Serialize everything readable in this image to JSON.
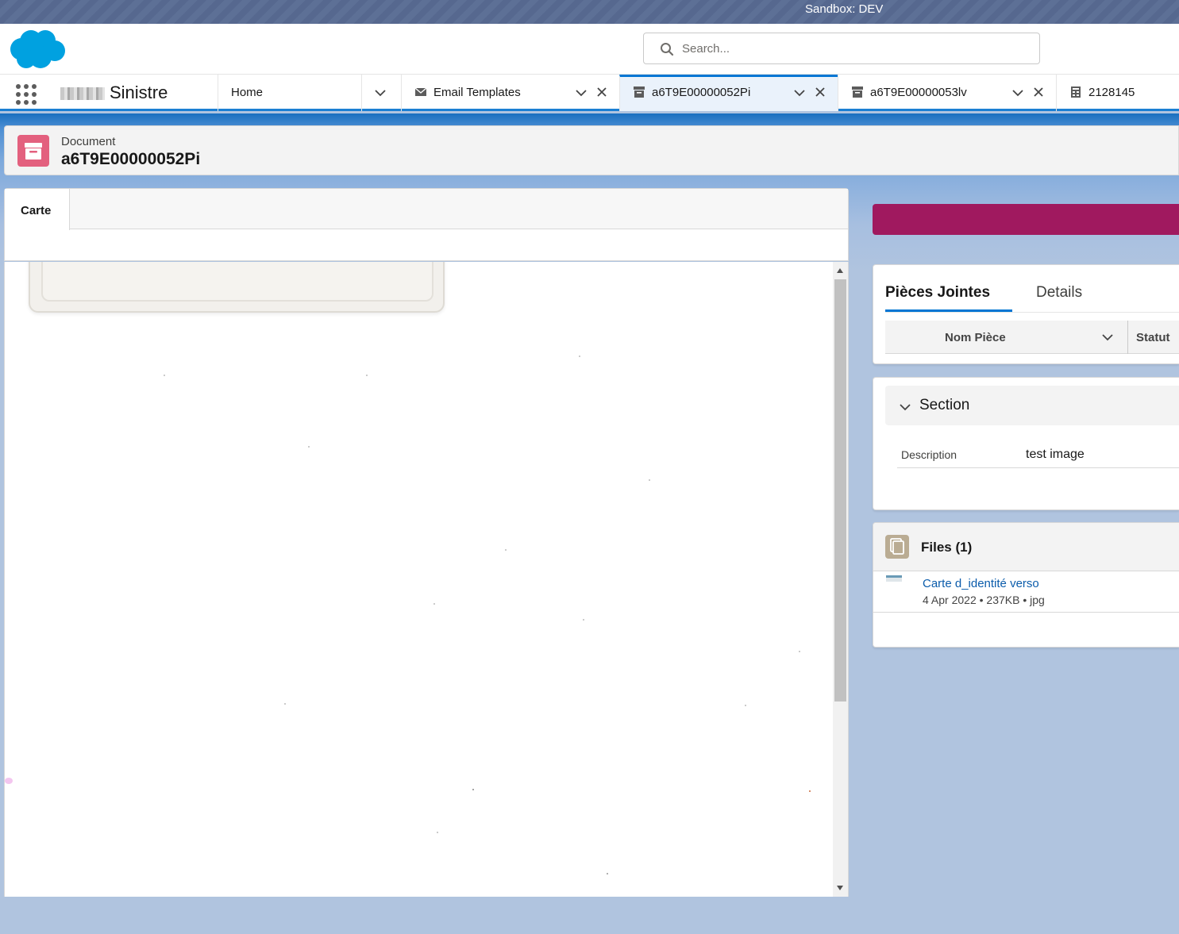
{
  "sandbox": {
    "label": "Sandbox: DEV"
  },
  "header": {
    "search_placeholder": "Search..."
  },
  "nav": {
    "app_name": "Sinistre",
    "tabs": [
      {
        "label": "Home"
      },
      {
        "label": "Email Templates"
      },
      {
        "label": "a6T9E00000052Pi"
      },
      {
        "label": "a6T9E00000053lv"
      },
      {
        "label": "2128145"
      }
    ]
  },
  "record": {
    "type": "Document",
    "title": "a6T9E00000052Pi"
  },
  "left_panel": {
    "tab_label": "Carte"
  },
  "right_panel": {
    "tabs": [
      {
        "label": "Pièces Jointes"
      },
      {
        "label": "Details"
      }
    ],
    "table_columns": [
      "Nom Pièce",
      "Statut"
    ],
    "section": {
      "title": "Section",
      "fields": [
        {
          "label": "Description",
          "value": "test image"
        }
      ]
    },
    "files": {
      "title": "Files (1)",
      "items": [
        {
          "name": "Carte d_identité verso",
          "meta": "4 Apr 2022 • 237KB • jpg"
        }
      ]
    }
  },
  "colors": {
    "brand": "#0176d3",
    "action_bar": "#a0195f",
    "record_icon": "#e3607e",
    "files_icon": "#baac93"
  },
  "icons": {
    "logo": "salesforce-cloud-logo",
    "search": "search-icon",
    "app_launcher": "app-launcher-grid-icon",
    "email": "envelope-icon",
    "record": "archive-box-icon",
    "case": "case-icon",
    "chevron": "chevron-down-icon",
    "close": "close-icon",
    "files": "files-icon"
  }
}
